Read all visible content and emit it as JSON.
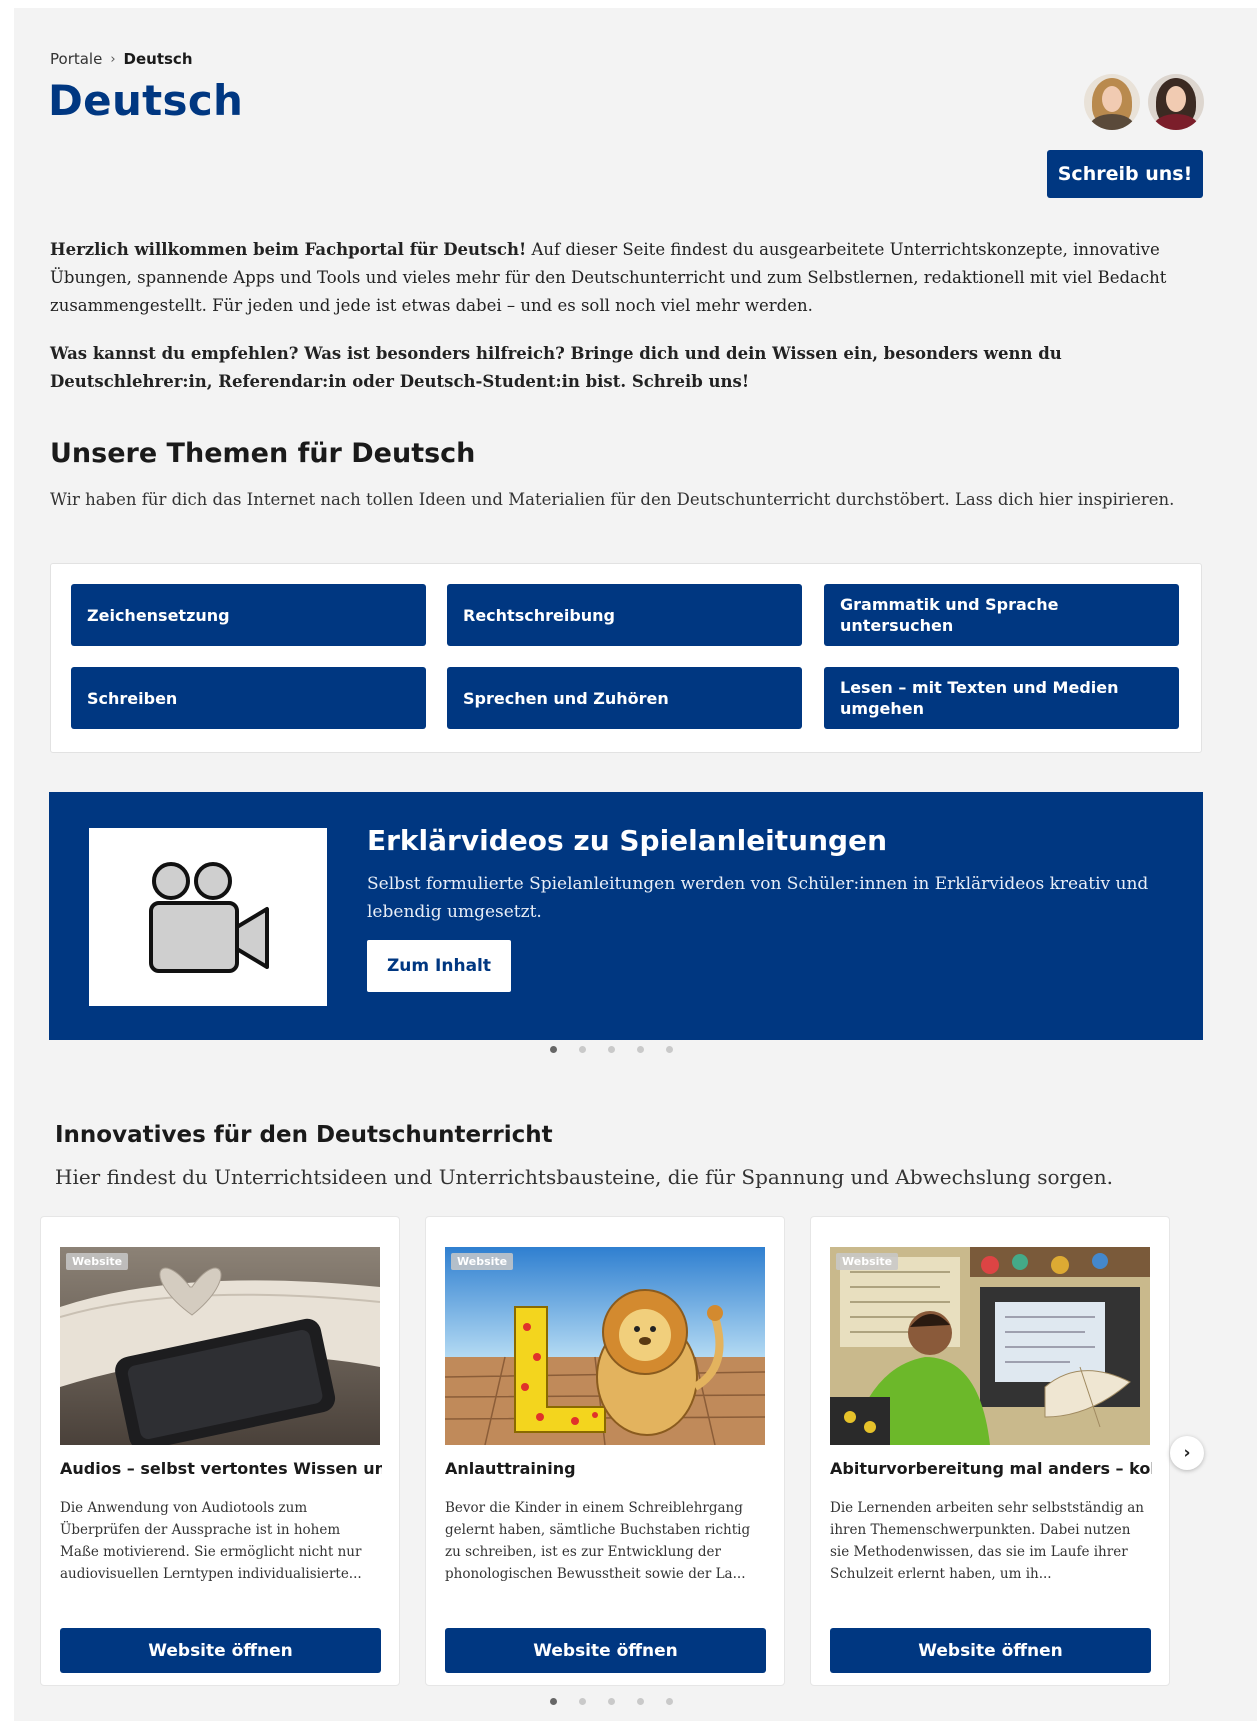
{
  "breadcrumb": {
    "root": "Portale",
    "separator": "›",
    "current": "Deutsch"
  },
  "page_title": "Deutsch",
  "contact_button": "Schreib uns!",
  "intro": {
    "p1_bold": "Herzlich willkommen beim Fachportal für Deutsch!",
    "p1_rest": " Auf dieser Seite findest du ausgearbeitete Unterrichtskonzepte, innovative Übungen, spannende Apps und Tools und vieles mehr für den Deutschunterricht und zum Selbstlernen, redaktionell mit viel Bedacht zusammengestellt.  Für jeden und jede ist etwas dabei – und es soll noch viel mehr werden.",
    "p2_bold": "Was kannst du empfehlen? Was ist besonders hilfreich? Bringe dich und dein Wissen ein, besonders wenn du Deutschlehrer:in, Referendar:in oder Deutsch-Student:in bist. Schreib uns!"
  },
  "topics": {
    "title": "Unsere Themen für Deutsch",
    "lead": "Wir haben für dich das Internet nach tollen Ideen und Materialien für den Deutschunterricht durchstöbert. Lass dich hier inspirieren.",
    "items": [
      "Zeichensetzung",
      "Rechtschreibung",
      "Grammatik und Sprache untersuchen",
      "Schreiben",
      "Sprechen und Zuhören",
      "Lesen – mit Texten und Medien umgehen"
    ]
  },
  "hero": {
    "title": "Erklärvideos zu Spielanleitungen",
    "description": "Selbst formulierte Spielanleitungen werden von Schüler:innen in Erklärvideos kreativ und lebendig umgesetzt.",
    "button": "Zum Inhalt",
    "icon": "video-camera-icon",
    "slides": 5,
    "active_slide": 1
  },
  "innovatives": {
    "title": "Innovatives für den Deutschunterricht",
    "lead": "Hier findest du Unterrichtsideen und Unterrichtsbausteine, die für Spannung und Abwechslung sorgen.",
    "cards": [
      {
        "tag": "Website",
        "title": "Audios – selbst vertontes Wissen un...",
        "description": "Die Anwendung von Audiotools zum Überprüfen der Aussprache ist in hohem Maße motivierend. Sie ermöglicht nicht nur audiovisuellen Lerntypen individualisierte...",
        "button": "Website öffnen"
      },
      {
        "tag": "Website",
        "title": "Anlauttraining",
        "description": "Bevor die Kinder in einem Schreiblehrgang gelernt haben, sämtliche Buchstaben richtig zu schreiben, ist es zur Entwicklung der phonologischen Bewusstheit sowie der La...",
        "button": "Website öffnen"
      },
      {
        "tag": "Website",
        "title": "Abiturvorbereitung mal anders – kol...",
        "description": "Die Lernenden arbeiten sehr selbstständig an ihren Themenschwerpunkten. Dabei nutzen sie Methodenwissen, das sie im Laufe ihrer Schulzeit erlernt haben, um ih...",
        "button": "Website öffnen"
      }
    ],
    "next_arrow": "›",
    "slides": 5,
    "active_slide": 1
  },
  "colors": {
    "brand": "#003781",
    "background": "#f3f3f3"
  }
}
